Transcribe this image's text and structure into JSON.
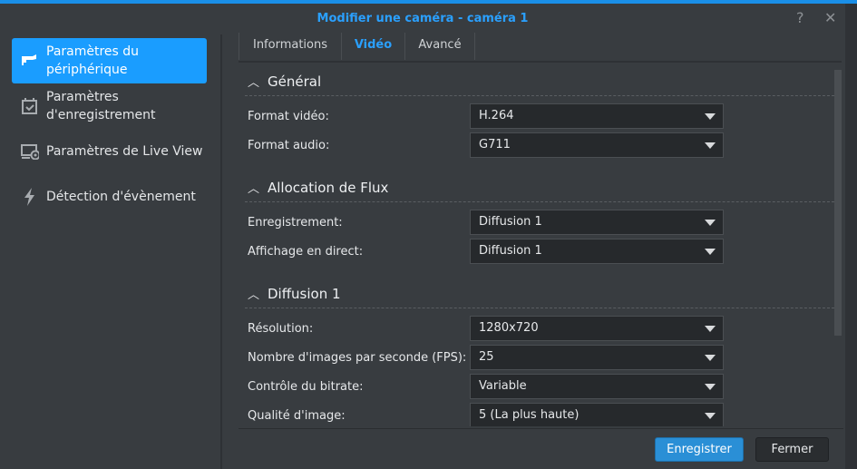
{
  "title": "Modifier une caméra - caméra 1",
  "header": {
    "help": "?",
    "close": "✕"
  },
  "sidebar": {
    "items": [
      {
        "label1": "Paramètres du",
        "label2": "périphérique"
      },
      {
        "label1": "Paramètres",
        "label2": "d'enregistrement"
      },
      {
        "label1": "Paramètres de Live View"
      },
      {
        "label1": "Détection d'évènement"
      }
    ]
  },
  "tabs": [
    "Informations",
    "Vidéo",
    "Avancé"
  ],
  "sections": [
    {
      "title": "Général",
      "rows": [
        {
          "label": "Format vidéo:",
          "value": "H.264"
        },
        {
          "label": "Format audio:",
          "value": "G711"
        }
      ]
    },
    {
      "title": "Allocation de Flux",
      "rows": [
        {
          "label": "Enregistrement:",
          "value": "Diffusion 1"
        },
        {
          "label": "Affichage en direct:",
          "value": "Diffusion 1"
        }
      ]
    },
    {
      "title": "Diffusion 1",
      "rows": [
        {
          "label": "Résolution:",
          "value": "1280x720"
        },
        {
          "label": "Nombre d'images par seconde (FPS):",
          "value": "25"
        },
        {
          "label": "Contrôle du bitrate:",
          "value": "Variable"
        },
        {
          "label": "Qualité d'image:",
          "value": "5 (La plus haute)"
        }
      ]
    }
  ],
  "footer": {
    "save": "Enregistrer",
    "close": "Fermer"
  }
}
